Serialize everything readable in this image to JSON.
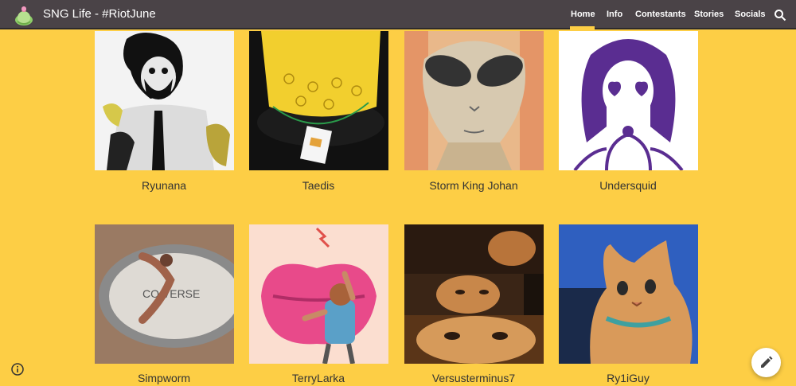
{
  "header": {
    "site_title": "SNG Life - #RiotJune",
    "logo_icon": "cactus-plant-icon",
    "nav": [
      {
        "label": "Home",
        "active": true
      },
      {
        "label": "Info",
        "active": false
      },
      {
        "label": "Contestants",
        "active": false
      },
      {
        "label": "Stories",
        "active": false
      },
      {
        "label": "Socials",
        "active": false
      }
    ],
    "search_icon": "search-icon"
  },
  "gallery": {
    "row1": [
      "Ryunana",
      "Taedis",
      "Storm King Johan",
      "Undersquid"
    ],
    "row2": [
      "Simpworm",
      "TerryLarka",
      "Versusterminus7",
      "Ry1iGuy"
    ]
  },
  "footer": {
    "info_icon": "info-icon",
    "edit_icon": "pencil-icon"
  },
  "colors": {
    "background": "#FDCE45",
    "header": "#4a4347",
    "accent": "#FDCE45",
    "undersquid_purple": "#5a2d91"
  }
}
